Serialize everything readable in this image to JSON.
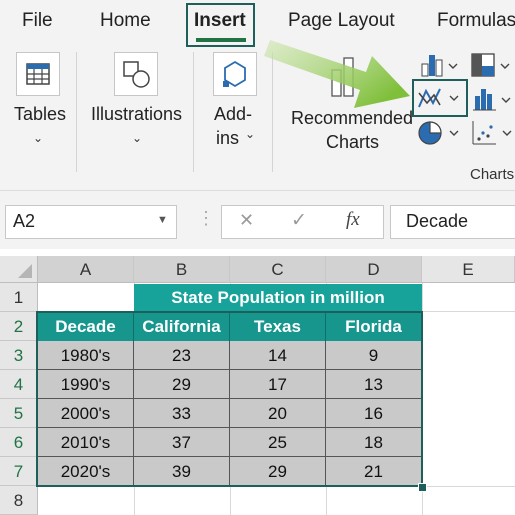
{
  "ribbon": {
    "tabs": [
      "File",
      "Home",
      "Insert",
      "Page Layout",
      "Formulas"
    ],
    "active_tab": "Insert",
    "groups": {
      "tables": "Tables",
      "illustrations": "Illustrations",
      "addins_line1": "Add-",
      "addins_line2": "ins",
      "recommended_line1": "Recommended",
      "recommended_line2": "Charts",
      "charts": "Charts"
    },
    "icons": [
      "table-icon",
      "illustrations-icon",
      "addins-icon",
      "recommended-charts-icon",
      "column-chart-icon",
      "hierarchy-chart-icon",
      "line-chart-icon",
      "statistic-chart-icon",
      "pie-chart-icon",
      "scatter-chart-icon"
    ],
    "accent_color": "#217346"
  },
  "formula_bar": {
    "name_box": "A2",
    "cancel_symbol": "✕",
    "enter_symbol": "✓",
    "fx_symbol": "fx",
    "value": "Decade"
  },
  "grid": {
    "columns": [
      "A",
      "B",
      "C",
      "D",
      "E"
    ],
    "rows": [
      "1",
      "2",
      "3",
      "4",
      "5",
      "6",
      "7",
      "8"
    ],
    "title": "State Population in million",
    "headers": [
      "Decade",
      "California",
      "Texas",
      "Florida"
    ],
    "data": [
      [
        "1980's",
        "23",
        "14",
        "9"
      ],
      [
        "1990's",
        "29",
        "17",
        "13"
      ],
      [
        "2000's",
        "33",
        "20",
        "16"
      ],
      [
        "2010's",
        "37",
        "25",
        "18"
      ],
      [
        "2020's",
        "39",
        "29",
        "21"
      ]
    ],
    "header_color": "#17968e",
    "data_fill_color": "#c9c9c9"
  }
}
